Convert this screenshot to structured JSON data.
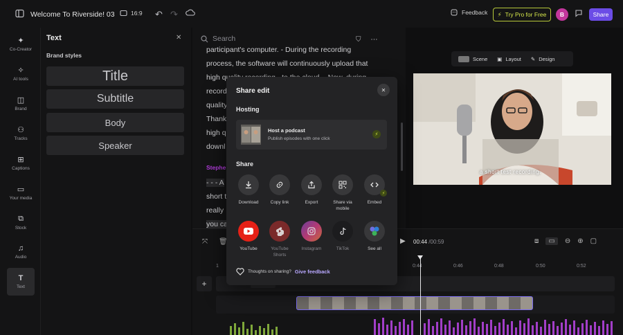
{
  "topbar": {
    "project_title": "Welcome To Riverside! 03",
    "aspect_ratio": "16:9",
    "feedback_label": "Feedback",
    "try_pro_label": "Try Pro for Free",
    "avatar_initial": "B",
    "share_label": "Share"
  },
  "rail": {
    "items": [
      {
        "label": "Co-Creator",
        "icon": "sparkle-icon"
      },
      {
        "label": "AI tools",
        "icon": "magic-icon"
      },
      {
        "label": "Brand",
        "icon": "palette-icon"
      },
      {
        "label": "Tracks",
        "icon": "people-icon"
      },
      {
        "label": "Captions",
        "icon": "captions-icon"
      },
      {
        "label": "Your media",
        "icon": "folder-icon"
      },
      {
        "label": "Stock",
        "icon": "stock-icon"
      },
      {
        "label": "Audio",
        "icon": "music-icon"
      },
      {
        "label": "Text",
        "icon": "text-icon"
      }
    ]
  },
  "text_panel": {
    "title": "Text",
    "subtitle": "Brand styles",
    "styles": [
      "Title",
      "Subtitle",
      "Body",
      "Speaker"
    ]
  },
  "transcript": {
    "search_placeholder": "Search",
    "lines": [
      "participant's computer. - During the recording",
      "process, the software will continuously upload that",
      "high quality recording - to the cloud. - Now, during",
      "recording",
      "quality",
      "Thank",
      "high q",
      "downl"
    ],
    "speaker": "Stephe",
    "lines_after": [
      "- - - A",
      "short t",
      "really",
      "you ca"
    ]
  },
  "preview": {
    "tabs": [
      "Scene",
      "Layout",
      "Design"
    ],
    "caption": "a short test recording."
  },
  "timeline": {
    "current_time": "00:44",
    "total_time": "/00:59",
    "ticks": [
      "1",
      "0:44",
      "0:46",
      "0:48",
      "0:50",
      "0:52"
    ]
  },
  "modal": {
    "title": "Share edit",
    "hosting_heading": "Hosting",
    "host_title": "Host a podcast",
    "host_subtitle": "Publish episodes with one click",
    "share_heading": "Share",
    "share_row1": [
      {
        "label": "Download",
        "icon": "download-icon"
      },
      {
        "label": "Copy link",
        "icon": "link-icon"
      },
      {
        "label": "Export",
        "icon": "export-icon"
      },
      {
        "label": "Share via mobile",
        "icon": "qr-icon"
      },
      {
        "label": "Embed",
        "icon": "embed-icon"
      }
    ],
    "share_row2": [
      {
        "label": "YouTube",
        "icon": "youtube-icon"
      },
      {
        "label": "YouTube Shorts",
        "icon": "youtube-shorts-icon"
      },
      {
        "label": "Instagram",
        "icon": "instagram-icon"
      },
      {
        "label": "TikTok",
        "icon": "tiktok-icon"
      },
      {
        "label": "See all",
        "icon": "see-all-icon"
      }
    ],
    "footer_text": "Thoughts on sharing?",
    "footer_link": "Give feedback"
  },
  "colors": {
    "accent": "#6b4ce6",
    "pro_border": "#b8c93a",
    "speaker": "#b23cdc",
    "youtube": "#e62117"
  }
}
